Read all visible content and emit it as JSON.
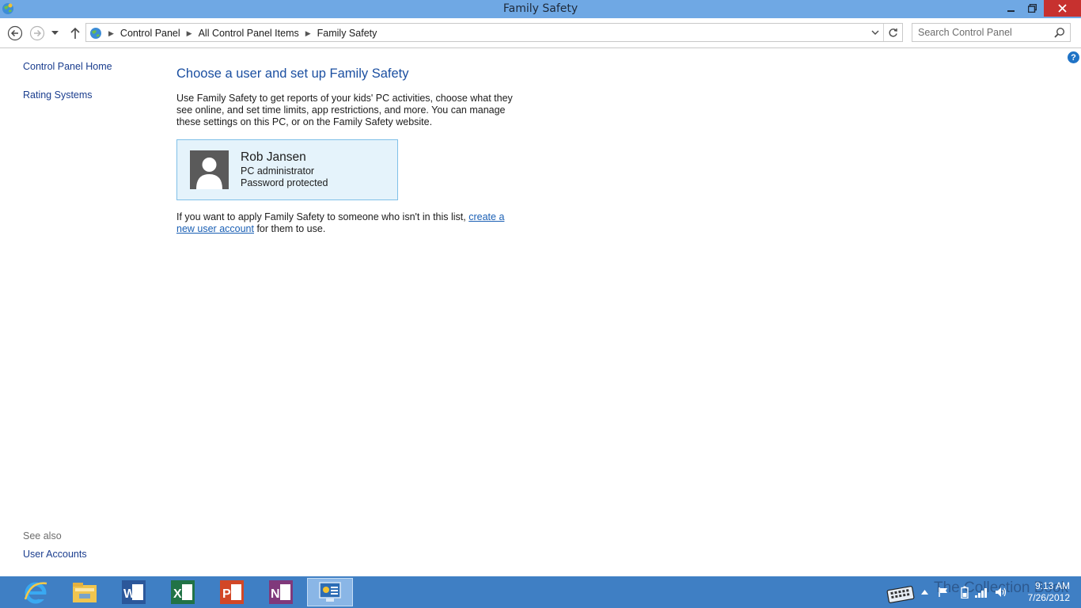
{
  "window": {
    "title": "Family Safety"
  },
  "address": {
    "crumbs": [
      "Control Panel",
      "All Control Panel Items",
      "Family Safety"
    ]
  },
  "search": {
    "placeholder": "Search Control Panel"
  },
  "sidebar": {
    "links": [
      "Control Panel Home",
      "Rating Systems"
    ],
    "see_also_label": "See also",
    "see_also_links": [
      "User Accounts"
    ]
  },
  "main": {
    "heading": "Choose a user and set up Family Safety",
    "description": "Use Family Safety to get reports of your kids' PC activities, choose what they see online, and set time limits, app restrictions, and more. You can manage these settings on this PC, or on the Family Safety website.",
    "user": {
      "name": "Rob Jansen",
      "role": "PC administrator",
      "status": "Password protected"
    },
    "footnote_before": "If you want to apply Family Safety to someone who isn't in this list, ",
    "footnote_link": "create a new user account",
    "footnote_after": " for them to use."
  },
  "taskbar": {
    "apps": [
      "internet-explorer-icon",
      "file-explorer-icon",
      "word-icon",
      "excel-icon",
      "powerpoint-icon",
      "onenote-icon",
      "control-panel-icon"
    ],
    "watermark": "The Collection Book",
    "time": "9:13 AM",
    "date": "7/26/2012"
  },
  "colors": {
    "titlebar": "#6fa8e4",
    "taskbar": "#3f7fc4",
    "heading": "#1b4fa1",
    "tile_bg": "#e5f3fb",
    "tile_border": "#7fc0e8"
  }
}
